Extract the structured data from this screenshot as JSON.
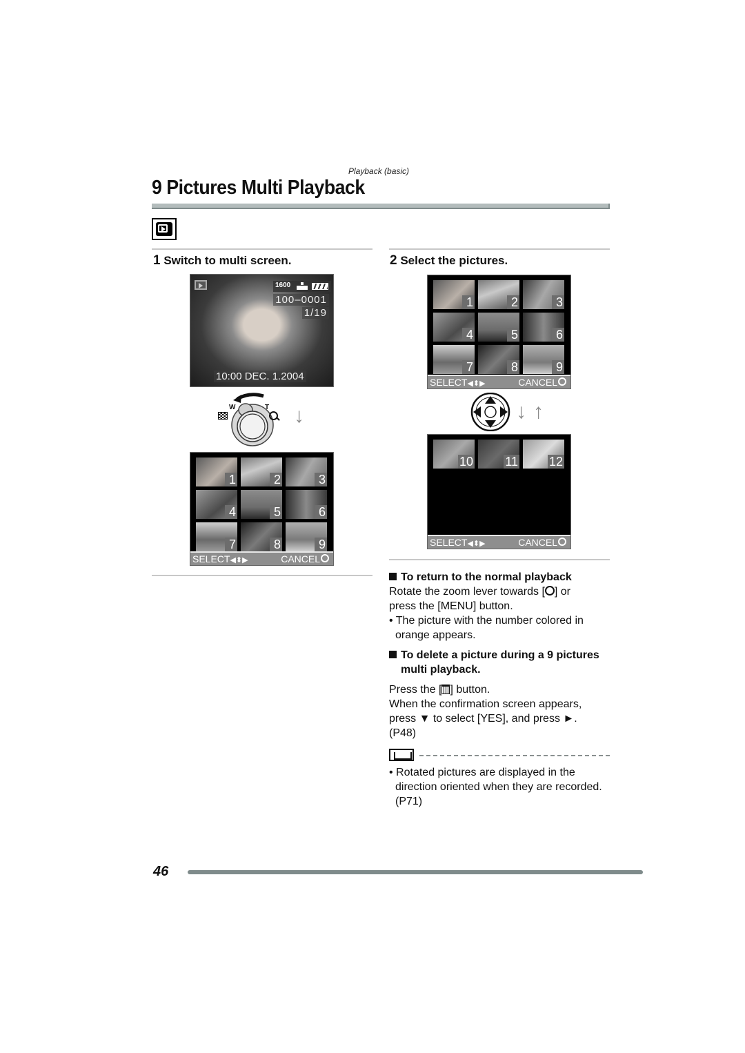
{
  "header": {
    "section_label": "Playback (basic)",
    "page_title": "9 Pictures Multi Playback",
    "mode_icon": "playback-mode-icon"
  },
  "step1": {
    "number": "1",
    "title": "Switch to multi screen.",
    "single_screen": {
      "iso": "1600",
      "quality_icon": "quality-icon",
      "battery_icon": "battery-icon",
      "file_number": "100–0001",
      "frame_count": "1/19",
      "datetime": "10:00  DEC. 1.2004"
    },
    "zoom_lever": {
      "wide_label": "W",
      "tele_label": "T",
      "wide_icon": "multi-playback-icon",
      "tele_icon": "zoom-magnifier-icon",
      "direction_icon": "arrow-down-icon"
    },
    "grid_screen": {
      "thumbnails": [
        "1",
        "2",
        "3",
        "4",
        "5",
        "6",
        "7",
        "8",
        "9"
      ],
      "select_label": "SELECT",
      "select_icon": "◀⬍▶",
      "cancel_label": "CANCEL"
    }
  },
  "step2": {
    "number": "2",
    "title": "Select the pictures.",
    "grid_screen_1": {
      "thumbnails": [
        "1",
        "2",
        "3",
        "4",
        "5",
        "6",
        "7",
        "8",
        "9"
      ],
      "select_label": "SELECT",
      "select_icon": "◀⬍▶",
      "cancel_label": "CANCEL"
    },
    "cursor_pad_icon": "cursor-button-icon",
    "direction_icons": [
      "↓",
      "↑"
    ],
    "grid_screen_2": {
      "thumbnails": [
        "10",
        "11",
        "12"
      ],
      "select_label": "SELECT",
      "select_icon": "◀⬍▶",
      "cancel_label": "CANCEL"
    }
  },
  "notes": {
    "return_heading": "To return to the normal playback",
    "return_text_1": "Rotate the zoom lever towards [",
    "return_text_2": "] or",
    "return_text_3": "press the [MENU] button.",
    "return_bullet_1": "The picture with the number colored in",
    "return_bullet_2": "orange appears.",
    "delete_heading_1": "To delete a picture during a 9 pictures",
    "delete_heading_2": "multi playback.",
    "delete_text_1a": "Press the [",
    "delete_text_1b": "] button.",
    "delete_text_2": "When the confirmation screen appears,",
    "delete_text_3a": "press ▼ to select [YES], and press ►.",
    "delete_text_4": "(P48)",
    "memo_bullet_1": "Rotated pictures are displayed in the",
    "memo_bullet_2": "direction oriented when they are recorded.",
    "memo_bullet_3": "(P71)"
  },
  "footer": {
    "page_number": "46"
  }
}
